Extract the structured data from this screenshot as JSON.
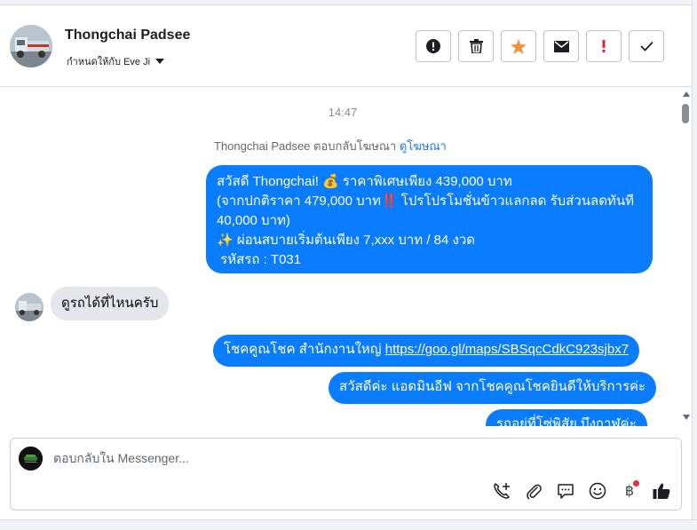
{
  "header": {
    "name": "Thongchai Padsee",
    "assigned_to": "กำหนดให้กับ Eve Ji",
    "actions": [
      {
        "name": "report-spam",
        "icon": "exclamation-circle-icon"
      },
      {
        "name": "delete",
        "icon": "trash-icon"
      },
      {
        "name": "star",
        "icon": "star-icon",
        "color": "#f7923a"
      },
      {
        "name": "mark-unread",
        "icon": "envelope-icon"
      },
      {
        "name": "flag-important",
        "icon": "exclamation-icon",
        "color": "#e41e3f"
      },
      {
        "name": "mark-done",
        "icon": "check-icon"
      }
    ]
  },
  "chat": {
    "timestamp": "14:47",
    "reply_note_prefix": "Thongchai Padsee ตอบกลับโฆษณา",
    "reply_note_link": "ดูโฆษณา",
    "msg1_line1": "สวัสดี Thongchai! 💰 ราคาพิเศษเพียง 439,000 บาท",
    "msg1_line2": "(จากปกติราคา 479,000 บาท‼️ โปรโปรโมชั่นข้าวแลกลด รับส่วนลดทันที",
    "msg1_line3": "40,000 บาท)",
    "msg1_line4": "✨ ผ่อนสบายเริ่มต้นเพียง 7,xxx บาท / 84 งวด",
    "msg1_line5": " รหัสรถ : T031",
    "incoming": "ดูรถได้ที่ไหนครับ",
    "msg2_text": "โชคคูณโชค สำนักงานใหญ่ ",
    "msg2_link": "https://goo.gl/maps/SBSqcCdkC923sjbx7",
    "msg3": "สวัสดีค่ะ แอดมินอีฟ จากโชคคูณโชคยินดีให้บริการค่ะ",
    "msg4": "รถอยู่ที่โซ่พิสัย บึงกาฬค่ะ"
  },
  "composer": {
    "placeholder": "ตอบกลับใน Messenger...",
    "tools": [
      "call-add-icon",
      "paperclip-icon",
      "saved-reply-icon",
      "emoji-icon",
      "baht-icon",
      "like-icon"
    ],
    "baht_symbol": "฿"
  },
  "colors": {
    "outgoing_bubble": "#0a7cff",
    "incoming_bubble": "#e4e6eb",
    "link": "#1877f2"
  }
}
